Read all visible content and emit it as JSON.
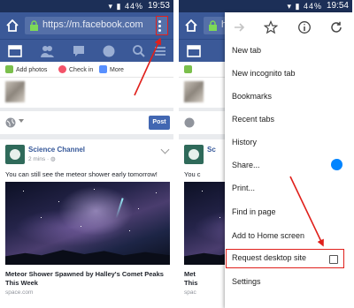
{
  "left": {
    "status": {
      "time": "19:53",
      "battery": "44%"
    },
    "url": "https://m.facebook.com",
    "composer": {
      "add_photos": "Add photos",
      "check_in": "Check in",
      "more": "More",
      "post_button": "Post"
    },
    "story": {
      "page_name": "Science Channel",
      "time_ago": "2 mins",
      "text": "You can still see the meteor shower early tomorrow!",
      "headline": "Meteor Shower Spawned by Halley's Comet Peaks This Week",
      "source": "space.com"
    }
  },
  "right": {
    "status": {
      "time": "19:54",
      "battery": "44%"
    },
    "url": "https",
    "story": {
      "page_name": "Sc",
      "text": "You c",
      "headline": "Met",
      "headline2": "This",
      "source": "spac"
    },
    "menu": {
      "items": [
        "New tab",
        "New incognito tab",
        "Bookmarks",
        "Recent tabs",
        "History",
        "Share...",
        "Print...",
        "Find in page",
        "Add to Home screen",
        "Request desktop site",
        "Settings"
      ]
    }
  },
  "colors": {
    "facebook_blue": "#3b5998",
    "highlight_red": "#e0201b",
    "messenger_blue": "#0084ff"
  },
  "icons": [
    "home-icon",
    "lock-icon",
    "menu-icon",
    "forward-icon",
    "star-icon",
    "info-icon",
    "refresh-icon",
    "globe-icon",
    "messenger-icon"
  ]
}
